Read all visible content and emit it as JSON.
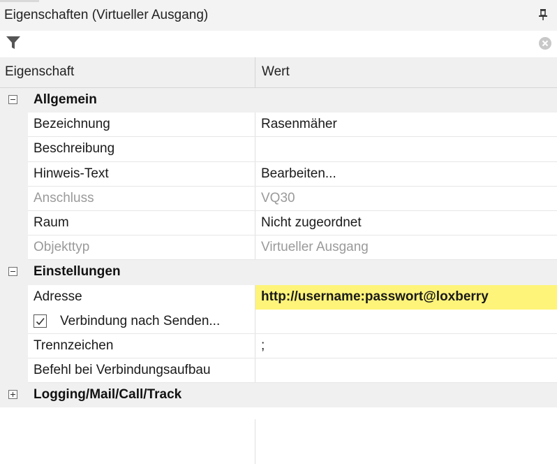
{
  "window": {
    "title": "Eigenschaften (Virtueller Ausgang)"
  },
  "columns": {
    "property": "Eigenschaft",
    "value": "Wert"
  },
  "categories": {
    "general": "Allgemein",
    "settings": "Einstellungen",
    "logging": "Logging/Mail/Call/Track"
  },
  "rows": {
    "bezeichnung": {
      "name": "Bezeichnung",
      "value": "Rasenmäher"
    },
    "beschreibung": {
      "name": "Beschreibung",
      "value": ""
    },
    "hinweis": {
      "name": "Hinweis-Text",
      "value": "Bearbeiten..."
    },
    "anschluss": {
      "name": "Anschluss",
      "value": "VQ30"
    },
    "raum": {
      "name": "Raum",
      "value": "Nicht zugeordnet"
    },
    "objekttyp": {
      "name": "Objekttyp",
      "value": "Virtueller Ausgang"
    },
    "adresse": {
      "name": "Adresse",
      "value": "http://username:passwort@loxberry"
    },
    "verbindung": {
      "name": "Verbindung nach Senden...",
      "value": "",
      "checked": true
    },
    "trennzeichen": {
      "name": "Trennzeichen",
      "value": ";"
    },
    "befehl": {
      "name": "Befehl bei Verbindungsaufbau",
      "value": ""
    }
  },
  "colors": {
    "highlight": "#fff47a",
    "gutter": "#f0f0f0",
    "disabled_text": "#9a9a9a"
  },
  "icons": {
    "pin": "pin-icon",
    "filter": "filter-icon",
    "clear": "clear-search-icon",
    "collapse": "collapse-icon",
    "expand": "expand-icon",
    "check": "check-icon"
  }
}
